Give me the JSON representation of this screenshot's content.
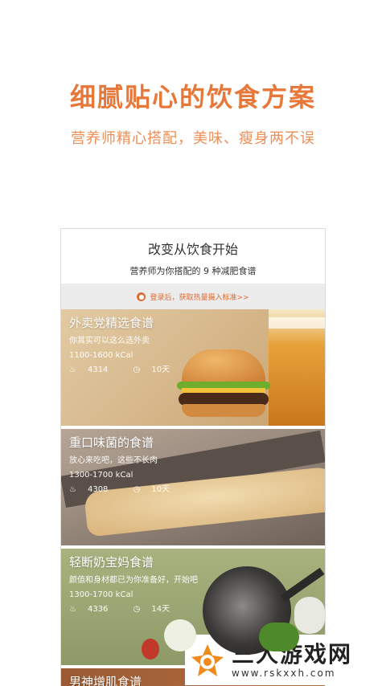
{
  "hero": {
    "title": "细腻贴心的饮食方案",
    "subtitle": "营养师精心搭配，美味、瘦身两不误"
  },
  "app": {
    "header_title": "改变从饮食开始",
    "header_subtitle": "营养师为你搭配的 9 种减肥食谱",
    "login_prompt": "登录后，获取热量摄入标准>>"
  },
  "recipes": [
    {
      "name": "外卖党精选食谱",
      "desc": "你其实可以这么选外卖",
      "kcal": "1100-1600 kCal",
      "views": "4314",
      "days": "10天"
    },
    {
      "name": "重口味菌的食谱",
      "desc": "放心来吃吧，这些不长肉",
      "kcal": "1300-1700 kCal",
      "views": "4308",
      "days": "10天"
    },
    {
      "name": "轻断奶宝妈食谱",
      "desc": "颜值和身材都已为你准备好，开始吧",
      "kcal": "1300-1700 kCal",
      "views": "4336",
      "days": "14天"
    },
    {
      "name": "男神增肌食谱"
    }
  ],
  "watermark": {
    "name": "三人游戏网",
    "url": "www.rskxxh.com"
  },
  "colors": {
    "accent": "#e8783a",
    "subtitle": "#ec8f57",
    "login_text": "#e06a2f"
  },
  "icons": {
    "views": "flame-icon",
    "days": "timer-icon",
    "login": "user-badge-icon"
  }
}
